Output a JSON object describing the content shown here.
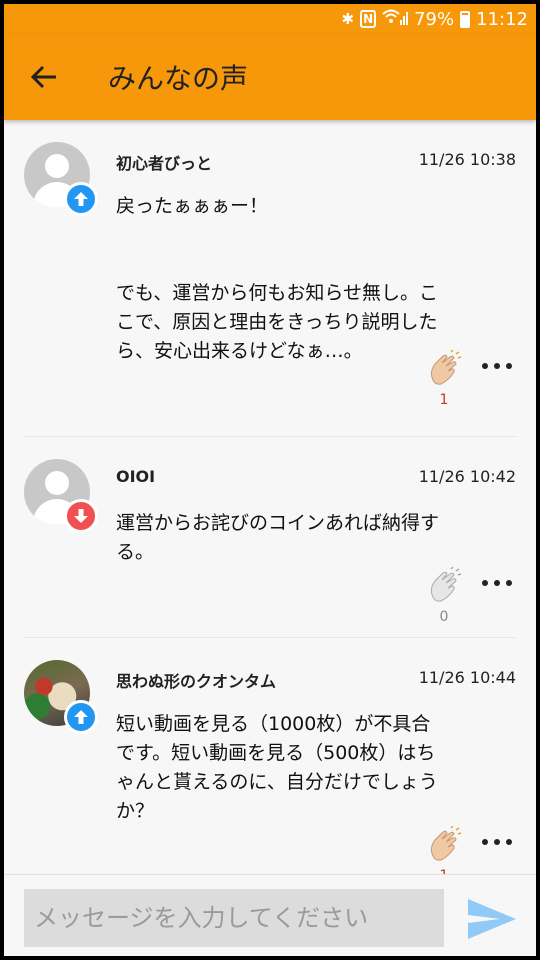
{
  "status_bar": {
    "battery": "79%",
    "time": "11:12"
  },
  "app_bar": {
    "title": "みんなの声"
  },
  "comments": [
    {
      "user": "初心者びっと",
      "time": "11/26 10:38",
      "text": "戻ったぁぁぁー！\n\n\nでも、運営から何もお知らせ無し。ここで、原因と理由をきっちり説明したら、安心出来るけどなぁ…。",
      "vote": "up",
      "claps": "1",
      "avatar": "default"
    },
    {
      "user": "OIOI",
      "time": "11/26 10:42",
      "text": "運営からお詫びのコインあれば納得する。",
      "vote": "down",
      "claps": "0",
      "avatar": "default"
    },
    {
      "user": "思わぬ形のクオンタム",
      "time": "11/26 10:44",
      "text": "短い動画を見る（1000枚）が不具合です。短い動画を見る（500枚）はちゃんと貰えるのに、自分だけでしょうか？",
      "vote": "up",
      "claps": "1",
      "avatar": "photo"
    }
  ],
  "composer": {
    "placeholder": "メッセージを入力してください"
  },
  "colors": {
    "accent": "#f7980a",
    "vote_up": "#2196f3",
    "vote_down": "#f05050",
    "send": "#90caf9"
  },
  "icons": {
    "back": "arrow-left-icon",
    "clap": "clapping-hands-icon",
    "more": "more-horizontal-icon",
    "send": "send-icon"
  }
}
